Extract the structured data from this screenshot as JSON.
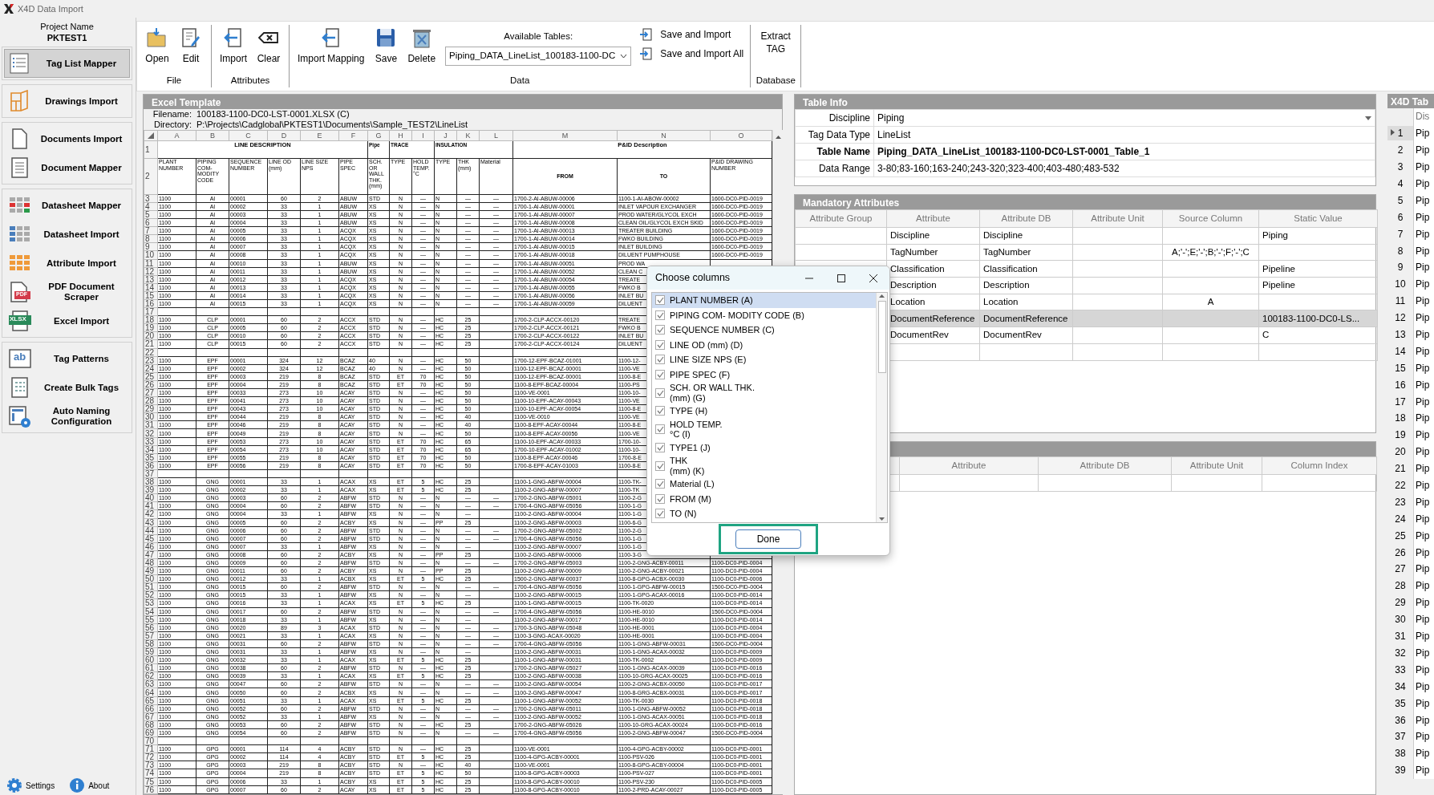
{
  "window": {
    "title": "X4D Data Import"
  },
  "project": {
    "label": "Project Name",
    "name": "PKTEST1"
  },
  "sidebar": {
    "groups": [
      {
        "items": [
          {
            "label": "Tag List Mapper",
            "selected": true
          }
        ]
      },
      {
        "items": [
          {
            "label": "Drawings Import",
            "selected": false
          }
        ]
      },
      {
        "items": [
          {
            "label": "Documents Import",
            "selected": false
          },
          {
            "label": "Document Mapper",
            "selected": false
          }
        ]
      },
      {
        "items": [
          {
            "label": "Datasheet Mapper",
            "selected": false
          },
          {
            "label": "Datasheet Import",
            "selected": false
          },
          {
            "label": "Attribute Import",
            "selected": false
          },
          {
            "label": "PDF Document Scraper",
            "selected": false,
            "icon_text": "PDF"
          },
          {
            "label": "Excel Import",
            "selected": false,
            "icon_text": "XLSX"
          }
        ]
      },
      {
        "items": [
          {
            "label": "Tag Patterns",
            "selected": false,
            "icon_text": "ab"
          },
          {
            "label": "Create Bulk Tags",
            "selected": false
          },
          {
            "label": "Auto Naming Configuration",
            "selected": false
          }
        ]
      }
    ],
    "footer": [
      "Settings",
      "About"
    ]
  },
  "ribbon": {
    "groups": [
      {
        "label": "File",
        "buttons": [
          "Open",
          "Edit"
        ]
      },
      {
        "label": "Attributes",
        "buttons": [
          "Import",
          "Clear"
        ]
      },
      {
        "label": "Data",
        "buttons": [
          "Import Mapping",
          "Save",
          "Delete"
        ],
        "tables": {
          "label": "Available Tables:",
          "value": "Piping_DATA_LineList_100183-1100-DC"
        },
        "actions": [
          "Save and Import",
          "Save and Import All"
        ]
      },
      {
        "label": "Database",
        "text_button": "Extract TAG"
      }
    ]
  },
  "excel": {
    "title": "Excel Template",
    "filename_label": "Filename:",
    "filename": "100183-1100-DC0-LST-0001.XLSX (C)",
    "directory_label": "Directory:",
    "directory": "P:\\Projects\\Cadglobal\\PKTEST1\\Documents\\Sample_TEST2\\LineList",
    "letters": [
      "A",
      "B",
      "C",
      "D",
      "E",
      "F",
      "G",
      "H",
      "I",
      "J",
      "K",
      "L",
      "M",
      "N",
      "O"
    ],
    "group_row_number": "1",
    "field_row_number": "2",
    "groups": [
      {
        "label": "LINE DESCRIPTION",
        "kind": "center",
        "fields": [
          {
            "text": "PLANT NUMBER",
            "kind": "small"
          },
          {
            "text": "PIPING COM- MODITY CODE",
            "kind": "small"
          },
          {
            "text": "SEQUENCE NUMBER",
            "kind": "small"
          },
          {
            "text": "LINE OD (mm)",
            "kind": "small"
          },
          {
            "text": "LINE SIZE NPS",
            "kind": "small"
          },
          {
            "text": "PIPE SPEC",
            "kind": "small"
          }
        ]
      },
      {
        "label": "Pipe",
        "kind": "left",
        "fields": [
          {
            "text": "SCH. OR WALL THK. (mm)",
            "kind": "small"
          }
        ]
      },
      {
        "label": "TRACE",
        "kind": "left",
        "fields": [
          {
            "text": "TYPE",
            "kind": "small"
          },
          {
            "text": "HOLD TEMP. °C",
            "kind": "small"
          }
        ]
      },
      {
        "label": "INSULATION",
        "kind": "left",
        "fields": [
          {
            "text": "TYPE",
            "kind": "small"
          },
          {
            "text": "THK (mm)",
            "kind": "small"
          },
          {
            "text": "Material",
            "kind": "small"
          }
        ]
      },
      {
        "label": "P&ID Description",
        "kind": "center",
        "fields": [
          {
            "text": "FROM",
            "kind": "main"
          },
          {
            "text": "TO",
            "kind": "main"
          },
          {
            "text": "P&ID DRAWING NUMBER",
            "kind": "small"
          }
        ]
      }
    ],
    "rows": [
      {
        "number": "3",
        "cells": [
          "1100",
          "AI",
          "00001",
          "60",
          "2",
          "ABUW",
          "STD",
          "N",
          "—",
          "N",
          "—",
          "—",
          "1700-2-AI-ABUW-00006",
          "1100-1-AI-ABOW-00002",
          "1600-DC0-PID-0019"
        ]
      },
      {
        "number": "4",
        "cells": [
          "1100",
          "AI",
          "00002",
          "33",
          "1",
          "ABUW",
          "XS",
          "N",
          "—",
          "N",
          "—",
          "—",
          "1700-1-AI-ABUW-00001",
          "INLET VAPOUR EXCHANGER",
          "1600-DC0-PID-0019"
        ]
      },
      {
        "number": "5",
        "cells": [
          "1100",
          "AI",
          "00003",
          "33",
          "1",
          "ABUW",
          "XS",
          "N",
          "—",
          "N",
          "—",
          "—",
          "1700-1-AI-ABUW-00007",
          "PROD WATER/GLYCOL EXCH",
          "1600-DC0-PID-0019"
        ]
      },
      {
        "number": "6",
        "cells": [
          "1100",
          "AI",
          "00004",
          "33",
          "1",
          "ABUW",
          "XS",
          "N",
          "—",
          "N",
          "—",
          "—",
          "1700-1-AI-ABUW-00008",
          "CLEAN OIL/GLYCOL EXCH SKID",
          "1600-DC0-PID-0019"
        ]
      },
      {
        "number": "7",
        "cells": [
          "1100",
          "AI",
          "00005",
          "33",
          "1",
          "ACQX",
          "XS",
          "N",
          "—",
          "N",
          "—",
          "—",
          "1700-1-AI-ABUW-00013",
          "TREATER  BUILDING",
          "1600-DC0-PID-0019"
        ]
      },
      {
        "number": "8",
        "cells": [
          "1100",
          "AI",
          "00006",
          "33",
          "1",
          "ACQX",
          "XS",
          "N",
          "—",
          "N",
          "—",
          "—",
          "1700-1-AI-ABUW-00014",
          "FWKO BUILDING",
          "1600-DC0-PID-0019"
        ]
      },
      {
        "number": "9",
        "cells": [
          "1100",
          "AI",
          "00007",
          "33",
          "1",
          "ACQX",
          "XS",
          "N",
          "—",
          "N",
          "—",
          "—",
          "1700-1-AI-ABUW-00015",
          "INLET BUILDING",
          "1600-DC0-PID-0019"
        ]
      },
      {
        "number": "10",
        "cells": [
          "1100",
          "AI",
          "00008",
          "33",
          "1",
          "ACQX",
          "XS",
          "N",
          "—",
          "N",
          "—",
          "—",
          "1700-1-AI-ABUW-00018",
          "DILUENT PUMPHOUSE",
          "1600-DC0-PID-0019"
        ]
      },
      {
        "number": "11",
        "cells": [
          "1100",
          "AI",
          "00010",
          "33",
          "1",
          "ABUW",
          "XS",
          "N",
          "—",
          "N",
          "—",
          "—",
          "1700-1-AI-ABUW-00051",
          "PROD WA",
          null
        ]
      },
      {
        "number": "12",
        "cells": [
          "1100",
          "AI",
          "00011",
          "33",
          "1",
          "ABUW",
          "XS",
          "N",
          "—",
          "N",
          "—",
          "—",
          "1700-1-AI-ABUW-00052",
          "CLEAN C",
          null
        ]
      },
      {
        "number": "13",
        "cells": [
          "1100",
          "AI",
          "00012",
          "33",
          "1",
          "ACQX",
          "XS",
          "N",
          "—",
          "N",
          "—",
          "—",
          "1700-1-AI-ABUW-00054",
          "TREATE",
          null
        ]
      },
      {
        "number": "14",
        "cells": [
          "1100",
          "AI",
          "00013",
          "33",
          "1",
          "ACQX",
          "XS",
          "N",
          "—",
          "N",
          "—",
          "—",
          "1700-1-AI-ABUW-00055",
          "FWKO B",
          null
        ]
      },
      {
        "number": "15",
        "cells": [
          "1100",
          "AI",
          "00014",
          "33",
          "1",
          "ACQX",
          "XS",
          "N",
          "—",
          "N",
          "—",
          "—",
          "1700-1-AI-ABUW-00056",
          "INLET BU",
          null
        ]
      },
      {
        "number": "16",
        "cells": [
          "1100",
          "AI",
          "00015",
          "33",
          "1",
          "ACQX",
          "XS",
          "N",
          "—",
          "N",
          "—",
          "—",
          "1700-1-AI-ABUW-00059",
          "DILUENT",
          null
        ]
      },
      {
        "number": "17"
      },
      {
        "number": "18",
        "cells": [
          "1100",
          "CLP",
          "00001",
          "60",
          "2",
          "ACCX",
          "STD",
          "N",
          "—",
          "HC",
          "25",
          null,
          "1700-2-CLP-ACCX-00120",
          "TREATE",
          null
        ]
      },
      {
        "number": "19",
        "cells": [
          "1100",
          "CLP",
          "00005",
          "60",
          "2",
          "ACCX",
          "STD",
          "N",
          "—",
          "HC",
          "25",
          null,
          "1700-2-CLP-ACCX-00121",
          "FWKO B",
          null
        ]
      },
      {
        "number": "20",
        "cells": [
          "1100",
          "CLP",
          "00010",
          "60",
          "2",
          "ACCX",
          "STD",
          "N",
          "—",
          "HC",
          "25",
          null,
          "1700-2-CLP-ACCX-00122",
          "INLET BU",
          null
        ]
      },
      {
        "number": "21",
        "cells": [
          "1100",
          "CLP",
          "00015",
          "60",
          "2",
          "ACCX",
          "STD",
          "N",
          "—",
          "HC",
          "25",
          null,
          "1700-2-CLP-ACCX-00124",
          "DILUENT",
          null
        ]
      },
      {
        "number": "22"
      },
      {
        "number": "23",
        "cells": [
          "1100",
          "EPF",
          "00001",
          "324",
          "12",
          "BCAZ",
          "40",
          "N",
          "—",
          "HC",
          "50",
          null,
          "1700-12-EPF-BCAZ-01001",
          "1100-12-",
          null
        ]
      },
      {
        "number": "24",
        "cells": [
          "1100",
          "EPF",
          "00002",
          "324",
          "12",
          "BCAZ",
          "40",
          "N",
          "—",
          "HC",
          "50",
          null,
          "1100-12-EPF-BCAZ-00001",
          "1100-VE",
          null
        ]
      },
      {
        "number": "25",
        "cells": [
          "1100",
          "EPF",
          "00003",
          "219",
          "8",
          "BCAZ",
          "STD",
          "ET",
          "70",
          "HC",
          "50",
          null,
          "1100-12-EPF-BCAZ-00001",
          "1100-8-E",
          null
        ]
      },
      {
        "number": "26",
        "cells": [
          "1100",
          "EPF",
          "00004",
          "219",
          "8",
          "BCAZ",
          "STD",
          "ET",
          "70",
          "HC",
          "50",
          null,
          "1100-8-EPF-BCAZ-00004",
          "1100-PS",
          null
        ]
      },
      {
        "number": "27",
        "cells": [
          "1100",
          "EPF",
          "00033",
          "273",
          "10",
          "ACAY",
          "STD",
          "N",
          "—",
          "HC",
          "50",
          null,
          "1100-VE-0001",
          "1100-10-",
          null
        ]
      },
      {
        "number": "28",
        "cells": [
          "1100",
          "EPF",
          "00041",
          "273",
          "10",
          "ACAY",
          "STD",
          "N",
          "—",
          "HC",
          "50",
          null,
          "1100-10-EPF-ACAY-00043",
          "1100-VE",
          null
        ]
      },
      {
        "number": "29",
        "cells": [
          "1100",
          "EPF",
          "00043",
          "273",
          "10",
          "ACAY",
          "STD",
          "N",
          "—",
          "HC",
          "50",
          null,
          "1100-10-EPF-ACAY-00054",
          "1100-8-E",
          null
        ]
      },
      {
        "number": "30",
        "cells": [
          "1100",
          "EPF",
          "00044",
          "219",
          "8",
          "ACAY",
          "STD",
          "N",
          "—",
          "HC",
          "40",
          null,
          "1100-VE-0010",
          "1100-VE",
          null
        ]
      },
      {
        "number": "31",
        "cells": [
          "1100",
          "EPF",
          "00046",
          "219",
          "8",
          "ACAY",
          "STD",
          "N",
          "—",
          "HC",
          "40",
          null,
          "1100-8-EPF-ACAY-00044",
          "1100-8-E",
          null
        ]
      },
      {
        "number": "32",
        "cells": [
          "1100",
          "EPF",
          "00049",
          "219",
          "8",
          "ACAY",
          "STD",
          "N",
          "—",
          "HC",
          "50",
          null,
          "1100-8-EPF-ACAY-00056",
          "1100-VE",
          null
        ]
      },
      {
        "number": "33",
        "cells": [
          "1100",
          "EPF",
          "00053",
          "273",
          "10",
          "ACAY",
          "STD",
          "ET",
          "70",
          "HC",
          "65",
          null,
          "1100-10-EPF-ACAY-00033",
          "1700-10-",
          null
        ]
      },
      {
        "number": "34",
        "cells": [
          "1100",
          "EPF",
          "00054",
          "273",
          "10",
          "ACAY",
          "STD",
          "ET",
          "70",
          "HC",
          "65",
          null,
          "1700-10-EPF-ACAY-01002",
          "1100-10-",
          null
        ]
      },
      {
        "number": "35",
        "cells": [
          "1100",
          "EPF",
          "00055",
          "219",
          "8",
          "ACAY",
          "STD",
          "ET",
          "70",
          "HC",
          "50",
          null,
          "1100-8-EPF-ACAY-00046",
          "1700-8-E",
          null
        ]
      },
      {
        "number": "36",
        "cells": [
          "1100",
          "EPF",
          "00056",
          "219",
          "8",
          "ACAY",
          "STD",
          "ET",
          "70",
          "HC",
          "50",
          null,
          "1700-8-EPF-ACAY-01003",
          "1100-8-E",
          null
        ]
      },
      {
        "number": "37"
      },
      {
        "number": "38",
        "cells": [
          "1100",
          "GNG",
          "00001",
          "33",
          "1",
          "ACAX",
          "XS",
          "ET",
          "5",
          "HC",
          "25",
          null,
          "1100-1-GNG-ABFW-00004",
          "1100-TK-",
          null
        ]
      },
      {
        "number": "39",
        "cells": [
          "1100",
          "GNG",
          "00002",
          "33",
          "1",
          "ACAX",
          "XS",
          "ET",
          "5",
          "HC",
          "25",
          null,
          "1100-2-GNG-ABFW-00007",
          "1100-TK",
          null
        ]
      },
      {
        "number": "40",
        "cells": [
          "1100",
          "GNG",
          "00003",
          "60",
          "2",
          "ABFW",
          "STD",
          "N",
          "—",
          "N",
          "—",
          "—",
          "1700-2-GNG-ABFW-05001",
          "1100-2-G",
          null
        ]
      },
      {
        "number": "41",
        "cells": [
          "1100",
          "GNG",
          "00004",
          "60",
          "2",
          "ABFW",
          "STD",
          "N",
          "—",
          "N",
          "—",
          "—",
          "1700-4-GNG-ABFW-05056",
          "1100-1-G",
          null
        ]
      },
      {
        "number": "42",
        "cells": [
          "1100",
          "GNG",
          "00004",
          "33",
          "1",
          "ABFW",
          "XS",
          "N",
          "—",
          "N",
          "—",
          null,
          "1100-2-GNG-ABFW-00004",
          "1100-1-G",
          null
        ]
      },
      {
        "number": "43",
        "cells": [
          "1100",
          "GNG",
          "00005",
          "60",
          "2",
          "ACBY",
          "XS",
          "N",
          "—",
          "PP",
          "25",
          null,
          "1100-2-GNG-ABFW-00003",
          "1100-6-G",
          null
        ]
      },
      {
        "number": "44",
        "cells": [
          "1100",
          "GNG",
          "00006",
          "60",
          "2",
          "ABFW",
          "STD",
          "N",
          "—",
          "N",
          "—",
          "—",
          "1700-2-GNG-ABFW-05002",
          "1100-2-G",
          null
        ]
      },
      {
        "number": "45",
        "cells": [
          "1100",
          "GNG",
          "00007",
          "60",
          "2",
          "ABFW",
          "STD",
          "N",
          "—",
          "N",
          "—",
          "—",
          "1700-4-GNG-ABFW-05056",
          "1100-1-G",
          null
        ]
      },
      {
        "number": "46",
        "cells": [
          "1100",
          "GNG",
          "00007",
          "33",
          "1",
          "ABFW",
          "XS",
          "N",
          "—",
          "N",
          "—",
          null,
          "1100-2-GNG-ABFW-00007",
          "1100-1-G",
          null
        ]
      },
      {
        "number": "47",
        "cells": [
          "1100",
          "GNG",
          "00008",
          "60",
          "2",
          "ACBY",
          "XS",
          "N",
          "—",
          "PP",
          "25",
          null,
          "1100-2-GNG-ABFW-00006",
          "1100-3-G",
          null
        ]
      },
      {
        "number": "48",
        "cells": [
          "1100",
          "GNG",
          "00009",
          "60",
          "2",
          "ABFW",
          "STD",
          "N",
          "—",
          "N",
          "—",
          "—",
          "1700-2-GNG-ABFW-05003",
          "1100-2-GNG-ACBY-00011",
          "1100-DC0-PID-0004"
        ]
      },
      {
        "number": "49",
        "cells": [
          "1100",
          "GNG",
          "00011",
          "60",
          "2",
          "ACBY",
          "XS",
          "N",
          "—",
          "PP",
          "25",
          null,
          "1100-2-GNG-ABFW-00009",
          "1100-2-GNG-ACBY-00021",
          "1100-DC0-PID-0004"
        ]
      },
      {
        "number": "50",
        "cells": [
          "1100",
          "GNG",
          "00012",
          "33",
          "1",
          "ACBX",
          "XS",
          "ET",
          "5",
          "HC",
          "25",
          null,
          "1500-2-GNG-ABFW-00037",
          "1100-8-GPG-ACBX-00030",
          "1100-DC0-PID-0006"
        ]
      },
      {
        "number": "51",
        "cells": [
          "1100",
          "GNG",
          "00015",
          "60",
          "2",
          "ABFW",
          "STD",
          "N",
          "—",
          "N",
          "—",
          "—",
          "1700-4-GNG-ABFW-05056",
          "1100-1-GPG-ABFW-00015",
          "1500-DC0-PID-0004"
        ]
      },
      {
        "number": "52",
        "cells": [
          "1100",
          "GNG",
          "00015",
          "33",
          "1",
          "ABFW",
          "XS",
          "N",
          "—",
          "N",
          "—",
          null,
          "1100-2-GNG-ABFW-00015",
          "1100-1-GPG-ACAX-00016",
          "1100-DC0-PID-0014"
        ]
      },
      {
        "number": "53",
        "cells": [
          "1100",
          "GNG",
          "00016",
          "33",
          "1",
          "ACAX",
          "XS",
          "ET",
          "5",
          "HC",
          "25",
          null,
          "1100-1-GNG-ABFW-00015",
          "1100-TK-0020",
          "1100-DC0-PID-0014"
        ]
      },
      {
        "number": "54",
        "cells": [
          "1100",
          "GNG",
          "00017",
          "60",
          "2",
          "ABFW",
          "STD",
          "N",
          "—",
          "N",
          "—",
          "—",
          "1700-4-GNG-ABFW-05056",
          "1100-HE-0010",
          "1500-DC0-PID-0004"
        ]
      },
      {
        "number": "55",
        "cells": [
          "1100",
          "GNG",
          "00018",
          "33",
          "1",
          "ABFW",
          "XS",
          "N",
          "—",
          "N",
          "—",
          null,
          "1100-2-GNG-ABFW-00017",
          "1100-HE-0010",
          "1100-DC0-PID-0014"
        ]
      },
      {
        "number": "56",
        "cells": [
          "1100",
          "GNG",
          "00020",
          "89",
          "3",
          "ACAX",
          "STD",
          "N",
          "—",
          "N",
          "—",
          "—",
          "1700-3-GNG-ABFW-05048",
          "1100-HE-0001",
          "1100-DC0-PID-0004"
        ]
      },
      {
        "number": "57",
        "cells": [
          "1100",
          "GNG",
          "00021",
          "33",
          "1",
          "ACAX",
          "XS",
          "N",
          "—",
          "N",
          "—",
          "—",
          "1100-3-GNG-ACAX-00020",
          "1100-HE-0001",
          "1100-DC0-PID-0004"
        ]
      },
      {
        "number": "58",
        "cells": [
          "1100",
          "GNG",
          "00031",
          "60",
          "2",
          "ABFW",
          "STD",
          "N",
          "—",
          "N",
          "—",
          "—",
          "1700-4-GNG-ABFW-05056",
          "1100-1-GNG-ABFW-00031",
          "1500-DC0-PID-0004"
        ]
      },
      {
        "number": "59",
        "cells": [
          "1100",
          "GNG",
          "00031",
          "33",
          "1",
          "ABFW",
          "XS",
          "N",
          "—",
          "N",
          "—",
          null,
          "1100-2-GNG-ABFW-00031",
          "1100-1-GNG-ACAX-00032",
          "1100-DC0-PID-0009"
        ]
      },
      {
        "number": "60",
        "cells": [
          "1100",
          "GNG",
          "00032",
          "33",
          "1",
          "ACAX",
          "XS",
          "ET",
          "5",
          "HC",
          "25",
          null,
          "1100-1-GNG-ABFW-00031",
          "1100-TK-0002",
          "1100-DC0-PID-0009"
        ]
      },
      {
        "number": "61",
        "cells": [
          "1100",
          "GNG",
          "00038",
          "60",
          "2",
          "ABFW",
          "STD",
          "N",
          "—",
          "HC",
          "25",
          null,
          "1700-2-GNG-ABFW-05027",
          "1100-1-GNG-ACAX-00039",
          "1100-DC0-PID-0016"
        ]
      },
      {
        "number": "62",
        "cells": [
          "1100",
          "GNG",
          "00039",
          "33",
          "1",
          "ACAX",
          "XS",
          "ET",
          "5",
          "HC",
          "25",
          null,
          "1100-2-GNG-ABFW-00038",
          "1100-10-GRG-ACAX-00025",
          "1100-DC0-PID-0016"
        ]
      },
      {
        "number": "63",
        "cells": [
          "1100",
          "GNG",
          "00047",
          "60",
          "2",
          "ABFW",
          "STD",
          "N",
          "—",
          "N",
          "—",
          "—",
          "1100-2-GNG-ABFW-00054",
          "1100-2-GNG-ACBX-00050",
          "1100-DC0-PID-0017"
        ]
      },
      {
        "number": "64",
        "cells": [
          "1100",
          "GNG",
          "00050",
          "60",
          "2",
          "ACBX",
          "XS",
          "N",
          "—",
          "N",
          "—",
          "—",
          "1100-2-GNG-ABFW-00047",
          "1100-8-GRG-ACBX-00031",
          "1100-DC0-PID-0017"
        ]
      },
      {
        "number": "65",
        "cells": [
          "1100",
          "GNG",
          "00051",
          "33",
          "1",
          "ACAX",
          "XS",
          "ET",
          "5",
          "HC",
          "25",
          null,
          "1100-1-GNG-ABFW-00052",
          "1100-TK-0030",
          "1100-DC0-PID-0018"
        ]
      },
      {
        "number": "66",
        "cells": [
          "1100",
          "GNG",
          "00052",
          "60",
          "2",
          "ABFW",
          "STD",
          "N",
          "—",
          "N",
          "—",
          "—",
          "1700-2-GNG-ABFW-05011",
          "1100-1-GNG-ABFW-00052",
          "1100-DC0-PID-0018"
        ]
      },
      {
        "number": "67",
        "cells": [
          "1100",
          "GNG",
          "00052",
          "33",
          "1",
          "ABFW",
          "XS",
          "N",
          "—",
          "N",
          "—",
          "—",
          "1100-2-GNG-ABFW-00052",
          "1100-1-GNG-ACAX-00051",
          "1100-DC0-PID-0018"
        ]
      },
      {
        "number": "68",
        "cells": [
          "1100",
          "GNG",
          "00053",
          "60",
          "2",
          "ABFW",
          "STD",
          "N",
          "—",
          "HC",
          "25",
          null,
          "1700-2-GNG-ABFW-05026",
          "1100-10-GRG-ACAX-00024",
          "1100-DC0-PID-0016"
        ]
      },
      {
        "number": "69",
        "cells": [
          "1100",
          "GNG",
          "00054",
          "60",
          "2",
          "ABFW",
          "STD",
          "N",
          "—",
          "N",
          "—",
          "—",
          "1700-4-GNG-ABFW-05056",
          "1100-2-GNG-ABFW-00047",
          "1500-DC0-PID-0004"
        ]
      },
      {
        "number": "70"
      },
      {
        "number": "71",
        "cells": [
          "1100",
          "GPG",
          "00001",
          "114",
          "4",
          "ACBY",
          "STD",
          "N",
          "—",
          "HC",
          "25",
          null,
          "1100-VE-0001",
          "1100-4-GPG-ACBY-00002",
          "1100-DC0-PID-0001"
        ]
      },
      {
        "number": "72",
        "cells": [
          "1100",
          "GPG",
          "00002",
          "114",
          "4",
          "ACBY",
          "STD",
          "ET",
          "5",
          "HC",
          "25",
          null,
          "1100-4-GPG-ACBY-00001",
          "1100-PSV-026",
          "1100-DC0-PID-0001"
        ]
      },
      {
        "number": "73",
        "cells": [
          "1100",
          "GPG",
          "00003",
          "219",
          "8",
          "ACBY",
          "STD",
          "N",
          "—",
          "HC",
          "40",
          null,
          "1100-VE-0001",
          "1100-8-GPG-ACBY-00004",
          "1100-DC0-PID-0001"
        ]
      },
      {
        "number": "74",
        "cells": [
          "1100",
          "GPG",
          "00004",
          "219",
          "8",
          "ACBY",
          "STD",
          "ET",
          "5",
          "HC",
          "50",
          null,
          "1100-8-GPG-ACBY-00003",
          "1100-PSV-027",
          "1100-DC0-PID-0001"
        ]
      },
      {
        "number": "75",
        "cells": [
          "1100",
          "GPG",
          "00006",
          "33",
          "1",
          "ACBY",
          "XS",
          "ET",
          "5",
          "HC",
          "25",
          null,
          "1100-8-GPG-ACBY-00010",
          "1100-PSV-230",
          "1100-DC0-PID-0005"
        ]
      },
      {
        "number": "76",
        "cells": [
          "1100",
          "GPG",
          "00007",
          "60",
          "2",
          "ACAY",
          "XS",
          "ET",
          "5",
          "HC",
          "25",
          null,
          "1100-8-GPG-ACBY-00010",
          "1100-2-PRD-ACAY-00027",
          "1100-DC0-PID-0005"
        ]
      }
    ]
  },
  "table_info": {
    "title": "Table Info",
    "rows": [
      {
        "label": "Discipline",
        "value": "Piping",
        "kind": "dropdown"
      },
      {
        "label": "Tag Data Type",
        "value": "LineList",
        "kind": "text"
      },
      {
        "label": "Table Name",
        "value": "Piping_DATA_LineList_100183-1100-DC0-LST-0001_Table_1",
        "kind": "emphasis"
      },
      {
        "label": "Data Range",
        "value": "3-80;83-160;163-240;243-320;323-400;403-480;483-532",
        "kind": "text"
      }
    ]
  },
  "mandatory": {
    "title": "Mandatory Attributes",
    "columns": [
      "Attribute Group",
      "Attribute",
      "Attribute DB",
      "Attribute Unit",
      "Source Column",
      "Static Value"
    ],
    "rows": [
      {
        "cells": [
          null,
          "Discipline",
          "Discipline",
          null,
          null,
          "Piping"
        ],
        "selected": false
      },
      {
        "cells": [
          null,
          "TagNumber",
          "TagNumber",
          null,
          "A;'-';E;'-';B;'-';F;'-';C",
          null
        ],
        "selected": false
      },
      {
        "cells": [
          null,
          "Classification",
          "Classification",
          null,
          null,
          "Pipeline"
        ],
        "selected": false
      },
      {
        "cells": [
          null,
          "Description",
          "Description",
          null,
          null,
          "Pipeline"
        ],
        "selected": false
      },
      {
        "cells": [
          null,
          "Location",
          "Location",
          null,
          "A",
          null
        ],
        "selected": false
      },
      {
        "cells": [
          null,
          "DocumentReference",
          "DocumentReference",
          null,
          null,
          "100183-1100-DC0-LS..."
        ],
        "selected": true
      },
      {
        "cells": [
          null,
          "DocumentRev",
          "DocumentRev",
          null,
          null,
          "C"
        ],
        "selected": false
      },
      {
        "selected": false
      }
    ]
  },
  "optional": {
    "columns": [
      "Attribute",
      "Attribute DB",
      "Attribute Unit",
      "Column Index"
    ]
  },
  "x4d_table": {
    "title": "X4D Tab",
    "column": "Dis",
    "rows": [
      {
        "number": "1",
        "value": "Pip",
        "selected": true
      },
      {
        "number": "2",
        "value": "Pip",
        "selected": false
      },
      {
        "number": "3",
        "value": "Pip",
        "selected": false
      },
      {
        "number": "4",
        "value": "Pip",
        "selected": false
      },
      {
        "number": "5",
        "value": "Pip",
        "selected": false
      },
      {
        "number": "6",
        "value": "Pip",
        "selected": false
      },
      {
        "number": "7",
        "value": "Pip",
        "selected": false
      },
      {
        "number": "8",
        "value": "Pip",
        "selected": false
      },
      {
        "number": "9",
        "value": "Pip",
        "selected": false
      },
      {
        "number": "10",
        "value": "Pip",
        "selected": false
      },
      {
        "number": "11",
        "value": "Pip",
        "selected": false
      },
      {
        "number": "12",
        "value": "Pip",
        "selected": false
      },
      {
        "number": "13",
        "value": "Pip",
        "selected": false
      },
      {
        "number": "14",
        "value": "Pip",
        "selected": false
      },
      {
        "number": "15",
        "value": "Pip",
        "selected": false
      },
      {
        "number": "16",
        "value": "Pip",
        "selected": false
      },
      {
        "number": "17",
        "value": "Pip",
        "selected": false
      },
      {
        "number": "18",
        "value": "Pip",
        "selected": false
      },
      {
        "number": "19",
        "value": "Pip",
        "selected": false
      },
      {
        "number": "20",
        "value": "Pip",
        "selected": false
      },
      {
        "number": "21",
        "value": "Pip",
        "selected": false
      },
      {
        "number": "22",
        "value": "Pip",
        "selected": false
      },
      {
        "number": "23",
        "value": "Pip",
        "selected": false
      },
      {
        "number": "24",
        "value": "Pip",
        "selected": false
      },
      {
        "number": "25",
        "value": "Pip",
        "selected": false
      },
      {
        "number": "26",
        "value": "Pip",
        "selected": false
      },
      {
        "number": "27",
        "value": "Pip",
        "selected": false
      },
      {
        "number": "28",
        "value": "Pip",
        "selected": false
      },
      {
        "number": "29",
        "value": "Pip",
        "selected": false
      },
      {
        "number": "30",
        "value": "Pip",
        "selected": false
      },
      {
        "number": "31",
        "value": "Pip",
        "selected": false
      },
      {
        "number": "32",
        "value": "Pip",
        "selected": false
      },
      {
        "number": "33",
        "value": "Pip",
        "selected": false
      },
      {
        "number": "34",
        "value": "Pip",
        "selected": false
      },
      {
        "number": "35",
        "value": "Pip",
        "selected": false
      },
      {
        "number": "36",
        "value": "Pip",
        "selected": false
      },
      {
        "number": "37",
        "value": "Pip",
        "selected": false
      },
      {
        "number": "38",
        "value": "Pip",
        "selected": false
      },
      {
        "number": "39",
        "value": "Pip",
        "selected": false
      }
    ]
  },
  "dialog": {
    "title": "Choose columns",
    "items": [
      {
        "label": "PLANT NUMBER (A)",
        "checked": true,
        "selected": true
      },
      {
        "label": "PIPING COM- MODITY CODE (B)",
        "checked": true,
        "selected": false
      },
      {
        "label": "SEQUENCE NUMBER (C)",
        "checked": true,
        "selected": false
      },
      {
        "label": "LINE OD (mm) (D)",
        "checked": true,
        "selected": false
      },
      {
        "label": "LINE SIZE NPS (E)",
        "checked": true,
        "selected": false
      },
      {
        "label": "PIPE SPEC (F)",
        "checked": true,
        "selected": false
      },
      {
        "label": "SCH. OR WALL THK.\n(mm) (G)",
        "checked": true,
        "selected": false
      },
      {
        "label": "TYPE (H)",
        "checked": true,
        "selected": false
      },
      {
        "label": "HOLD TEMP.\n°C (I)",
        "checked": true,
        "selected": false
      },
      {
        "label": "TYPE1 (J)",
        "checked": true,
        "selected": false
      },
      {
        "label": "THK\n(mm) (K)",
        "checked": true,
        "selected": false
      },
      {
        "label": "Material (L)",
        "checked": true,
        "selected": false
      },
      {
        "label": "FROM (M)",
        "checked": true,
        "selected": false
      },
      {
        "label": "TO (N)",
        "checked": true,
        "selected": false
      }
    ],
    "button": "Done"
  }
}
